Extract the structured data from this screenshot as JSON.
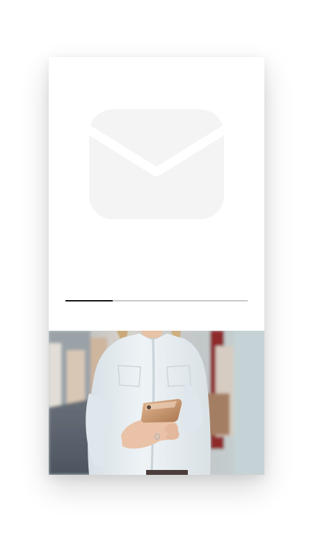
{
  "card": {
    "icon": "envelope-icon",
    "progress": 0.26,
    "colors": {
      "icon_fill": "#f4f4f4",
      "progress_track": "#c8c8c8",
      "progress_fill": "#111111"
    }
  },
  "photo": {
    "subject": "woman-holding-smartphone-image",
    "palette": {
      "blouse": "#e9eff3",
      "background": "#c6cfd4",
      "accent_red": "#8e2b2b",
      "phone": "#c7996f"
    }
  }
}
